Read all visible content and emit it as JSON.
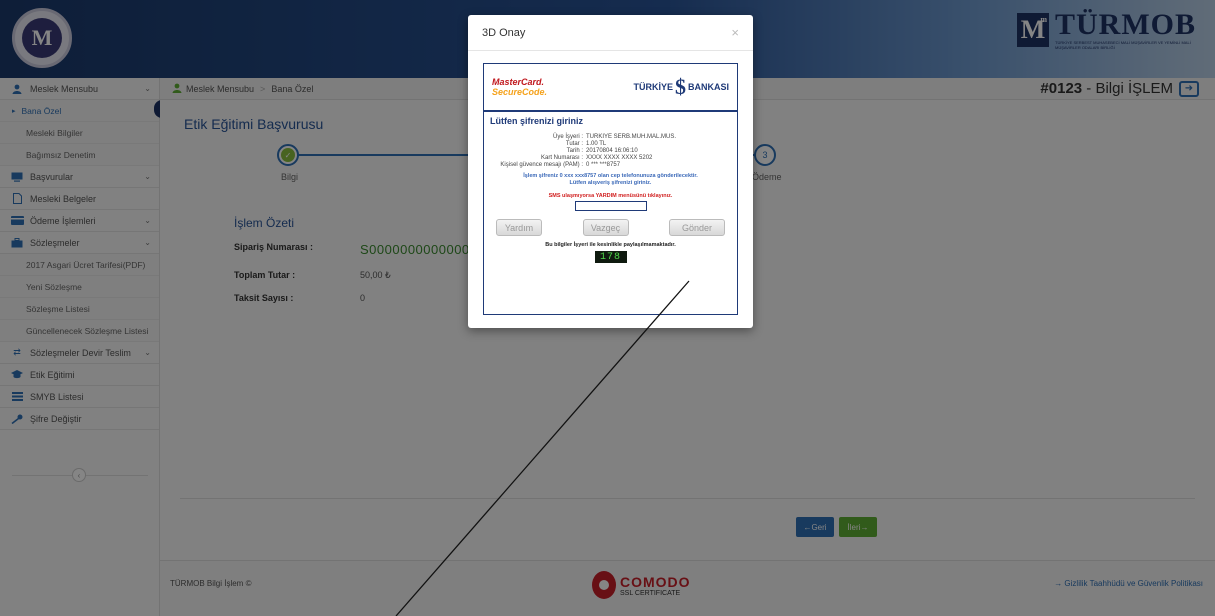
{
  "header": {
    "left_logo_letter": "M",
    "brand_m": "M",
    "brand_m_sup": "m",
    "brand_name": "TÜRMOB",
    "brand_sub": "TÜRKİYE SERBEST MUHASEBECİ MALİ MÜŞAVİRLER VE YEMİNLİ MALİ MÜŞAVİRLER ODALARI BİRLİĞİ"
  },
  "sidebar": {
    "items": [
      {
        "label": "Meslek Mensubu",
        "icon": "user-icon",
        "chevron": "⌄"
      },
      {
        "label": "Bana Özel",
        "sub": true,
        "active": true
      },
      {
        "label": "Mesleki Bilgiler",
        "sub": true
      },
      {
        "label": "Bağımsız Denetim",
        "sub": true
      },
      {
        "label": "Başvurular",
        "icon": "monitor-icon",
        "chevron": "⌄"
      },
      {
        "label": "Mesleki Belgeler",
        "icon": "document-icon"
      },
      {
        "label": "Ödeme İşlemleri",
        "icon": "card-icon",
        "chevron": "⌄"
      },
      {
        "label": "Sözleşmeler",
        "icon": "briefcase-icon",
        "chevron": "⌄"
      },
      {
        "label": "2017 Asgari Ücret Tarifesi(PDF)",
        "sub": true
      },
      {
        "label": "Yeni Sözleşme",
        "sub": true
      },
      {
        "label": "Sözleşme Listesi",
        "sub": true
      },
      {
        "label": "Güncellenecek Sözleşme Listesi",
        "sub": true
      },
      {
        "label": "Sözleşmeler Devir Teslim",
        "icon": "exchange-icon",
        "chevron": "⌄"
      },
      {
        "label": "Etik Eğitimi",
        "icon": "graduation-icon"
      },
      {
        "label": "SMYB Listesi",
        "icon": "list-icon"
      },
      {
        "label": "Şifre Değiştir",
        "icon": "key-icon"
      }
    ],
    "collapse_glyph": "‹"
  },
  "breadcrumb": {
    "home": "Meslek Mensubu",
    "sep": ">",
    "current": "Bana Özel"
  },
  "info": {
    "number": "#0123",
    "rest": " - Bilgi İŞLEM",
    "exit_glyph": "➜"
  },
  "main": {
    "title": "Etik Eğitimi Başvurusu",
    "steps": [
      {
        "label": "Bilgi",
        "done": true,
        "glyph": "✓"
      },
      {
        "label": "Ödeme",
        "number": "3"
      }
    ],
    "summary_title": "İşlem Özeti",
    "rows": [
      {
        "key": "Sipariş Numarası :",
        "value": "S0000000000000000"
      },
      {
        "key": "Toplam Tutar :",
        "value": "50,00 ₺"
      },
      {
        "key": "Taksit Sayısı :",
        "value": "0"
      }
    ],
    "btn_prev": "←Geri",
    "btn_next": "İleri→"
  },
  "footer": {
    "copy": "TÜRMOB Bilgi İşlem ©",
    "comodo_name": "COMODO",
    "comodo_ssl": "SSL CERTIFICATE",
    "policy": "→ Gizlilik Taahhüdü ve Güvenlik Politikası"
  },
  "modal": {
    "title": "3D Onay",
    "close": "×",
    "mc_line1": "MasterCard.",
    "mc_line2": "SecureCode.",
    "bank_left": "TÜRKİYE",
    "bank_symbol": "$",
    "bank_right": "BANKASI",
    "heading": "Lütfen şifrenizi giriniz",
    "details": [
      {
        "label": "Üye İşyeri :",
        "value": "TURKIYE SERB.MUH.MAL.MUS."
      },
      {
        "label": "Tutar :",
        "value": "1.00 TL"
      },
      {
        "label": "Tarih :",
        "value": "20170804 16:06:10"
      },
      {
        "label": "Kart Numarası :",
        "value": "XXXX XXXX XXXX 5202"
      },
      {
        "label": "Kişisel güvence mesajı (PAM) :",
        "value": "0 *** ***8757"
      }
    ],
    "msg_blue_1": "İşlem şifreniz 0 xxx xxx8757 olan cep telefonunuza gönderilecektir.",
    "msg_blue_2": "Lütfen alışveriş şifrenizi giriniz.",
    "msg_red": "SMS ulaşmıyorsa YARDIM menüsünü tıklayınız.",
    "btn_help": "Yardım",
    "btn_cancel": "Vazgeç",
    "btn_send": "Gönder",
    "notice": "Bu bilgiler İşyeri ile kesinlikle paylaşılmamaktadır.",
    "timer": "178"
  }
}
